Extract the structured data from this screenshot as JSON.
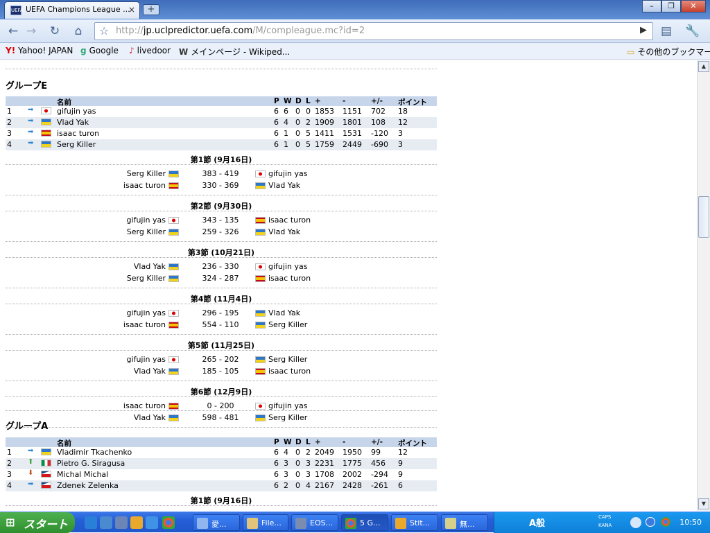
{
  "browser": {
    "tab_title": "UEFA Champions League ...",
    "tab_close": "×",
    "new_tab": "+",
    "url_prefix": "http://",
    "url_host": "jp.uclpredictor.uefa.com",
    "url_path": "/M/compleague.mc?id=2",
    "window_buttons": [
      "–",
      "❐",
      "✕"
    ],
    "bookmarks": [
      "Yahoo! JAPAN",
      "Google",
      "livedoor",
      "メインページ - Wikiped..."
    ],
    "other_bookmarks": "その他のブックマーク"
  },
  "table_headers": {
    "name": "名前",
    "p": "P",
    "w": "W",
    "d": "D",
    "l": "L",
    "plus": "+",
    "minus": "-",
    "diff": "+/-",
    "points": "ポイント"
  },
  "groups": [
    {
      "title": "グループE",
      "standings": [
        {
          "pos": "1",
          "trend": "right",
          "flag": "jp",
          "name": "gifujin yas",
          "p": "6",
          "w": "6",
          "d": "0",
          "l": "0",
          "plus": "1853",
          "minus": "1151",
          "diff": "702",
          "pts": "18"
        },
        {
          "pos": "2",
          "trend": "right",
          "flag": "ua",
          "name": "Vlad Yak",
          "p": "6",
          "w": "4",
          "d": "0",
          "l": "2",
          "plus": "1909",
          "minus": "1801",
          "diff": "108",
          "pts": "12"
        },
        {
          "pos": "3",
          "trend": "right",
          "flag": "es",
          "name": "isaac turon",
          "p": "6",
          "w": "1",
          "d": "0",
          "l": "5",
          "plus": "1411",
          "minus": "1531",
          "diff": "-120",
          "pts": "3"
        },
        {
          "pos": "4",
          "trend": "right",
          "flag": "ua",
          "name": "Serg Killer",
          "p": "6",
          "w": "1",
          "d": "0",
          "l": "5",
          "plus": "1759",
          "minus": "2449",
          "diff": "-690",
          "pts": "3"
        }
      ],
      "rounds": [
        {
          "title": "第1節 (9月16日)",
          "matches": [
            {
              "home": "Serg Killer",
              "home_flag": "ua",
              "score": "383 - 419",
              "away": "gifujin yas",
              "away_flag": "jp"
            },
            {
              "home": "isaac turon",
              "home_flag": "es",
              "score": "330 - 369",
              "away": "Vlad Yak",
              "away_flag": "ua"
            }
          ]
        },
        {
          "title": "第2節 (9月30日)",
          "matches": [
            {
              "home": "gifujin yas",
              "home_flag": "jp",
              "score": "343 - 135",
              "away": "isaac turon",
              "away_flag": "es"
            },
            {
              "home": "Serg Killer",
              "home_flag": "ua",
              "score": "259 - 326",
              "away": "Vlad Yak",
              "away_flag": "ua"
            }
          ]
        },
        {
          "title": "第3節 (10月21日)",
          "matches": [
            {
              "home": "Vlad Yak",
              "home_flag": "ua",
              "score": "236 - 330",
              "away": "gifujin yas",
              "away_flag": "jp"
            },
            {
              "home": "Serg Killer",
              "home_flag": "ua",
              "score": "324 - 287",
              "away": "isaac turon",
              "away_flag": "es"
            }
          ]
        },
        {
          "title": "第4節 (11月4日)",
          "matches": [
            {
              "home": "gifujin yas",
              "home_flag": "jp",
              "score": "296 - 195",
              "away": "Vlad Yak",
              "away_flag": "ua"
            },
            {
              "home": "isaac turon",
              "home_flag": "es",
              "score": "554 - 110",
              "away": "Serg Killer",
              "away_flag": "ua"
            }
          ]
        },
        {
          "title": "第5節 (11月25日)",
          "matches": [
            {
              "home": "gifujin yas",
              "home_flag": "jp",
              "score": "265 - 202",
              "away": "Serg Killer",
              "away_flag": "ua"
            },
            {
              "home": "Vlad Yak",
              "home_flag": "ua",
              "score": "185 - 105",
              "away": "isaac turon",
              "away_flag": "es"
            }
          ]
        },
        {
          "title": "第6節 (12月9日)",
          "matches": [
            {
              "home": "isaac turon",
              "home_flag": "es",
              "score": "0 - 200",
              "away": "gifujin yas",
              "away_flag": "jp"
            },
            {
              "home": "Vlad Yak",
              "home_flag": "ua",
              "score": "598 - 481",
              "away": "Serg Killer",
              "away_flag": "ua"
            }
          ]
        }
      ]
    },
    {
      "title": "グループA",
      "standings": [
        {
          "pos": "1",
          "trend": "right",
          "flag": "ua",
          "name": "Vladimir Tkachenko",
          "p": "6",
          "w": "4",
          "d": "0",
          "l": "2",
          "plus": "2049",
          "minus": "1950",
          "diff": "99",
          "pts": "12"
        },
        {
          "pos": "2",
          "trend": "up",
          "flag": "it",
          "name": "Pietro G. Siragusa",
          "p": "6",
          "w": "3",
          "d": "0",
          "l": "3",
          "plus": "2231",
          "minus": "1775",
          "diff": "456",
          "pts": "9"
        },
        {
          "pos": "3",
          "trend": "down",
          "flag": "cz",
          "name": "Michal Michal",
          "p": "6",
          "w": "3",
          "d": "0",
          "l": "3",
          "plus": "1708",
          "minus": "2002",
          "diff": "-294",
          "pts": "9"
        },
        {
          "pos": "4",
          "trend": "right",
          "flag": "cz",
          "name": "Zdenek Zelenka",
          "p": "6",
          "w": "2",
          "d": "0",
          "l": "4",
          "plus": "2167",
          "minus": "2428",
          "diff": "-261",
          "pts": "6"
        }
      ],
      "rounds": [
        {
          "title": "第1節 (9月16日)",
          "matches": []
        }
      ]
    }
  ],
  "taskbar": {
    "start": "スタート",
    "tasks": [
      "愛...",
      "File...",
      "EOS...",
      "5 G...",
      "Stit...",
      "無..."
    ],
    "tray_caps": "CAPS",
    "tray_kana": "KANA",
    "tray_ime": "A般",
    "clock": "10:50"
  }
}
